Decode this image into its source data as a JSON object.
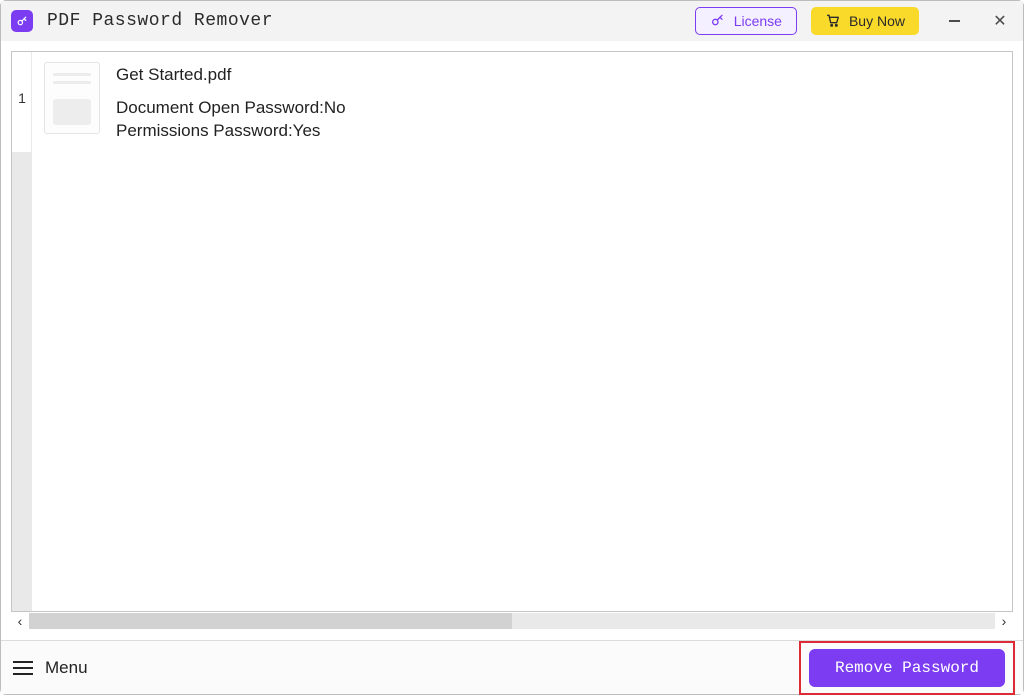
{
  "colors": {
    "accent": "#7b3cf2",
    "buy_bg": "#f9d92a",
    "highlight_border": "#dc2b34"
  },
  "titlebar": {
    "app_title": "PDF Password Remover",
    "license_label": "License",
    "buy_label": "Buy Now"
  },
  "files": [
    {
      "index": "1",
      "name": "Get Started.pdf",
      "open_password_line": "Document Open Password:No",
      "permissions_password_line": "Permissions Password:Yes"
    }
  ],
  "footer": {
    "menu_label": "Menu",
    "remove_label": "Remove Password"
  }
}
